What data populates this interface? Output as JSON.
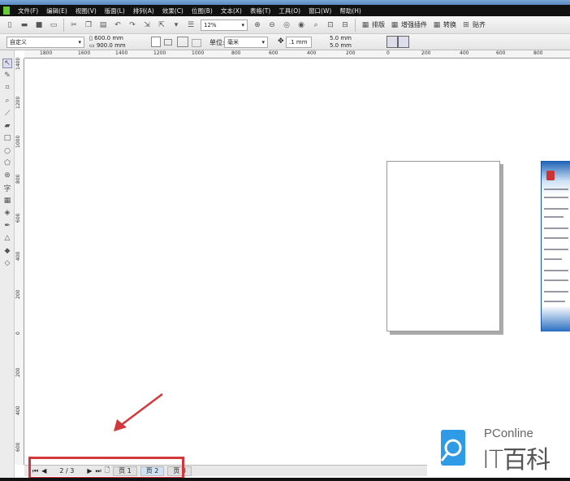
{
  "menu": [
    "文件(F)",
    "编辑(E)",
    "视图(V)",
    "版面(L)",
    "排列(A)",
    "效果(C)",
    "位图(B)",
    "文本(X)",
    "表格(T)",
    "工具(O)",
    "窗口(W)",
    "帮助(H)"
  ],
  "toolbar": {
    "zoom": "12%",
    "plugins": [
      "排版",
      "增强插件",
      "转换",
      "贴齐"
    ]
  },
  "propbar": {
    "page_preset": "自定义",
    "width": "600.0 mm",
    "height": "900.0 mm",
    "unit_label": "单位:",
    "unit": "毫米",
    "nudge": ".1 mm",
    "dup_x": "5.0 mm",
    "dup_y": "5.0 mm"
  },
  "hruler": [
    "1800",
    "1600",
    "1400",
    "1200",
    "1000",
    "800",
    "600",
    "400",
    "200",
    "0",
    "200",
    "400",
    "600",
    "800"
  ],
  "vruler": [
    "1400",
    "1200",
    "1000",
    "800",
    "600",
    "400",
    "200",
    "0",
    "200",
    "400",
    "600"
  ],
  "status": {
    "page_counter": "2 / 3",
    "tabs": [
      "页 1",
      "页 2",
      "页 3"
    ]
  },
  "watermark": {
    "brand": "PConline",
    "name": "IT百科"
  },
  "colors": {
    "highlight": "#d4373b",
    "logo_blue": "#2f9be6"
  }
}
